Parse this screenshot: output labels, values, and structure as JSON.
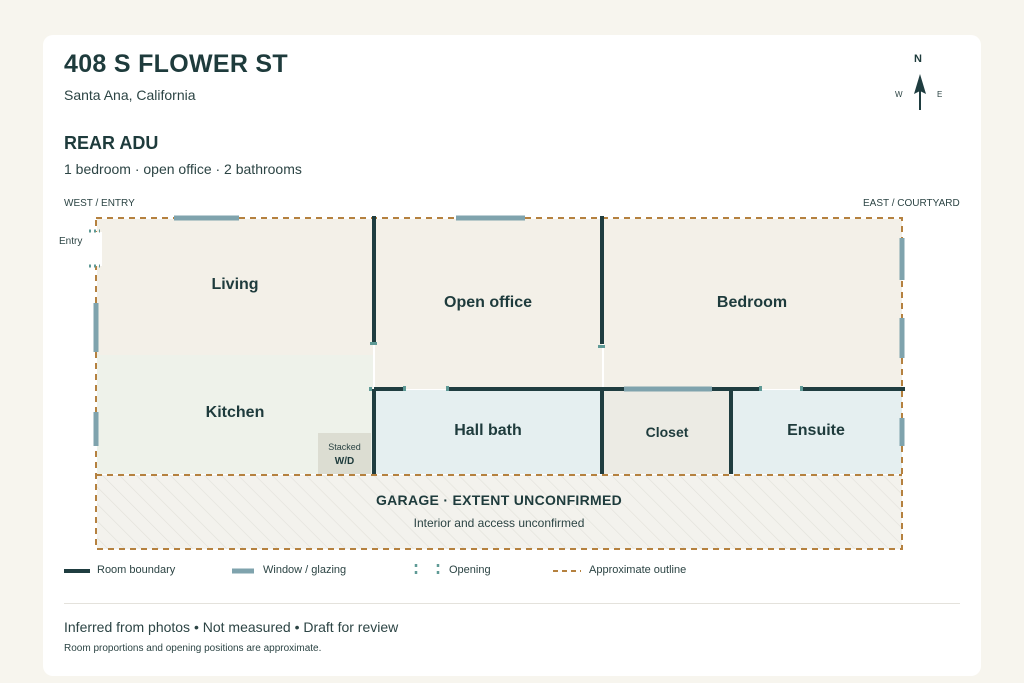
{
  "header": {
    "title": "408 S FLOWER ST",
    "subtitle": "Santa Ana, California",
    "section_title": "REAR ADU",
    "section_subtitle": "1 bedroom · open office · 2 bathrooms"
  },
  "compass": {
    "north": "N",
    "west": "W",
    "east": "E"
  },
  "plan": {
    "west_label": "WEST / ENTRY",
    "east_label": "EAST / COURTYARD",
    "entry_label": "Entry",
    "rooms": {
      "living": "Living",
      "open_office": "Open office",
      "bedroom": "Bedroom",
      "kitchen": "Kitchen",
      "hall_bath": "Hall bath",
      "closet": "Closet",
      "ensuite": "Ensuite"
    },
    "washer_dryer": {
      "line1": "Stacked",
      "line2": "W/D"
    },
    "garage": {
      "title": "GARAGE · EXTENT UNCONFIRMED",
      "subtitle": "Interior and access unconfirmed"
    }
  },
  "legend": {
    "room_boundary": "Room boundary",
    "window": "Window / glazing",
    "opening": "Opening",
    "approx_outline": "Approximate outline"
  },
  "footer": {
    "note": "Inferred from photos • Not measured • Draft for review",
    "subnote": "Room proportions and opening positions are approximate."
  },
  "colors": {
    "wall": "#1f3d40",
    "window": "#7fa3ad",
    "outline": "#b5813f",
    "living_fill": "#f3f0e8",
    "kitchen_fill": "#eef2ea",
    "bath_fill": "#e5eff0",
    "closet_fill": "#ecebe4",
    "wd_fill": "#dcddd2"
  }
}
